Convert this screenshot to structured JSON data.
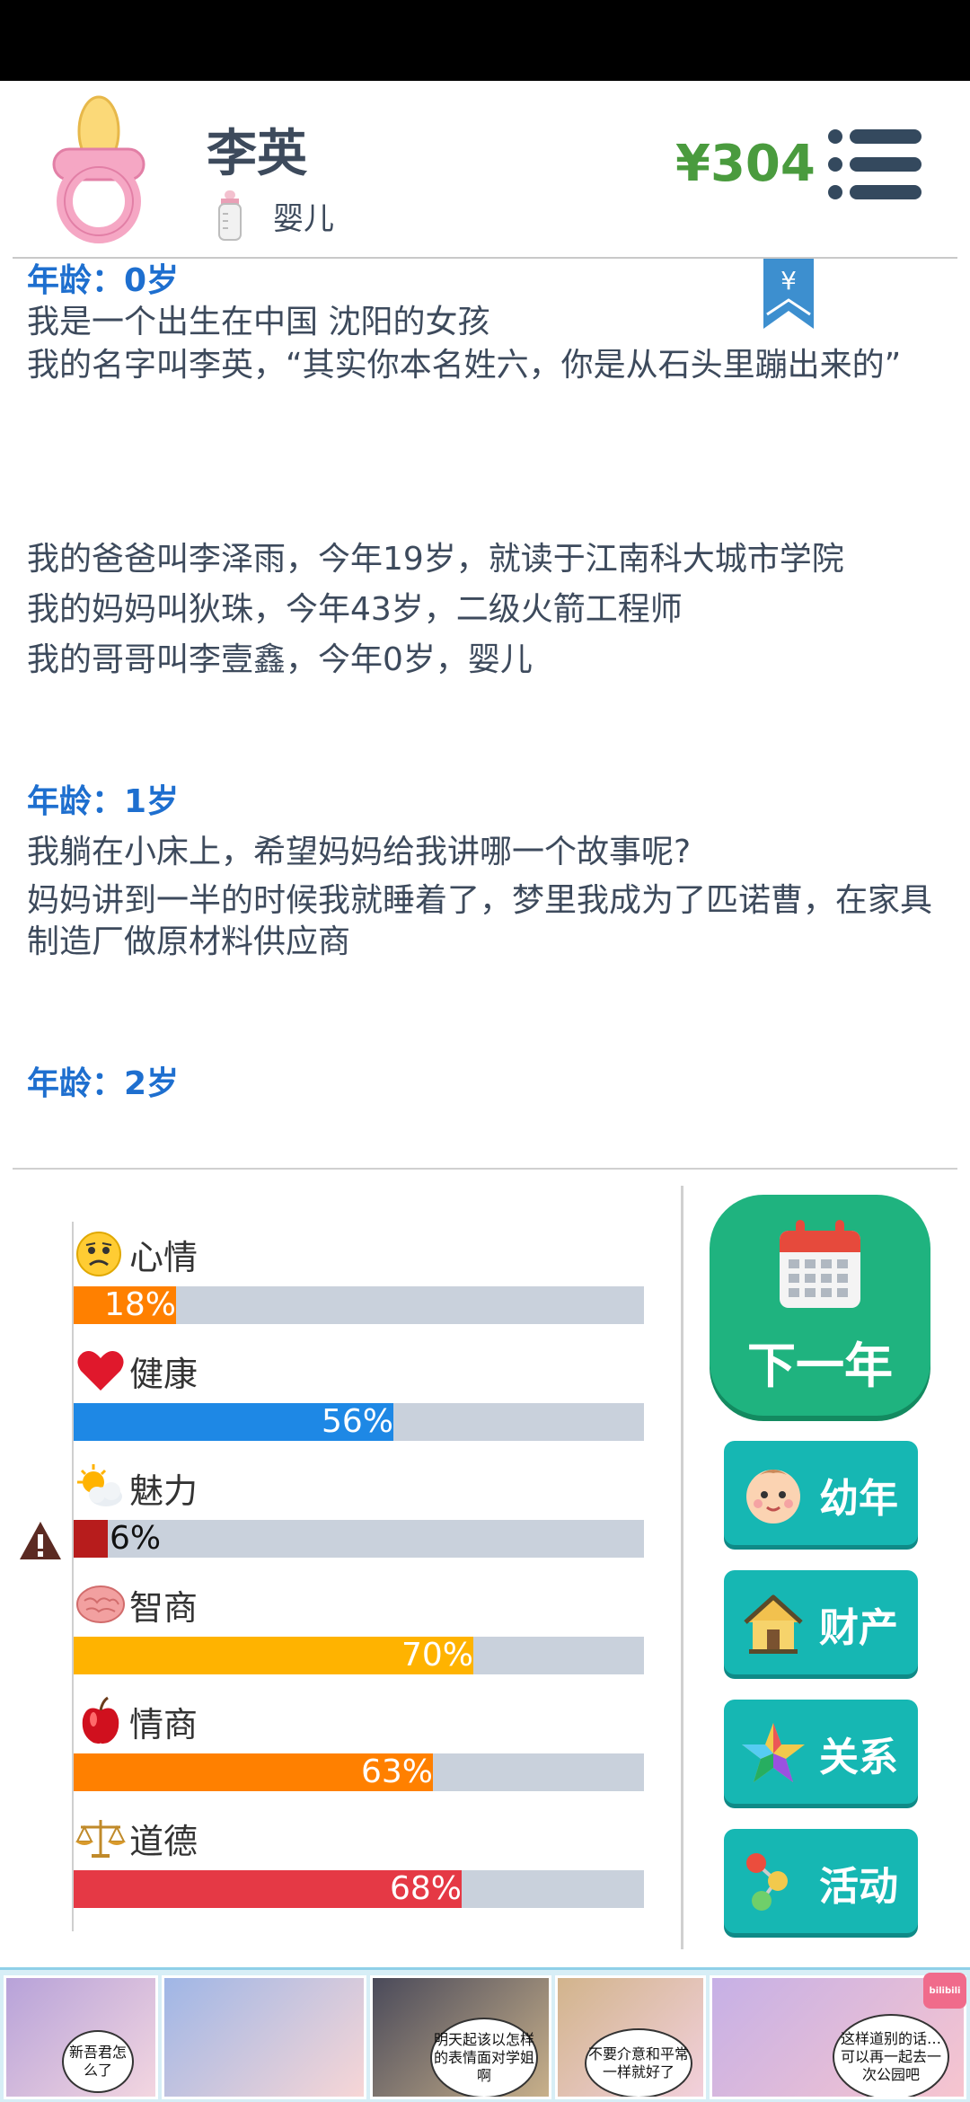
{
  "header": {
    "name": "李英",
    "stage_label": "婴儿",
    "money": "¥304"
  },
  "story": {
    "bookmark_symbol": "¥",
    "entries": [
      {
        "age_label": "年龄：0岁",
        "lines": [
          "我是一个出生在中国 沈阳的女孩",
          "我的名字叫李英，“其实你本名姓六，你是从石头里蹦出来的”",
          "",
          "我的爸爸叫李泽雨，今年19岁，就读于江南科大城市学院",
          "我的妈妈叫狄珠，今年43岁，二级火箭工程师",
          "我的哥哥叫李壹鑫，今年0岁，婴儿"
        ]
      },
      {
        "age_label": "年龄：1岁",
        "lines": [
          "我躺在小床上，希望妈妈给我讲哪一个故事呢?",
          "妈妈讲到一半的时候我就睡着了，梦里我成为了匹诺曹，在家具制造厂做原材料供应商"
        ]
      },
      {
        "age_label": "年龄：2岁",
        "lines": []
      }
    ]
  },
  "stats": [
    {
      "label": "心情",
      "value": 18,
      "text": "18%",
      "color": "#ff8000",
      "icon": "sad-face-icon"
    },
    {
      "label": "健康",
      "value": 56,
      "text": "56%",
      "color": "#1e88e5",
      "icon": "heart-icon"
    },
    {
      "label": "魅力",
      "value": 6,
      "text": "6%",
      "color": "#b71c1c",
      "icon": "sun-cloud-icon",
      "warning": true
    },
    {
      "label": "智商",
      "value": 70,
      "text": "70%",
      "color": "#ffb300",
      "icon": "brain-icon"
    },
    {
      "label": "情商",
      "value": 63,
      "text": "63%",
      "color": "#ff8000",
      "icon": "apple-icon"
    },
    {
      "label": "道德",
      "value": 68,
      "text": "68%",
      "color": "#e53945",
      "icon": "scales-icon"
    }
  ],
  "actions": {
    "next_year": "下一年",
    "childhood": "幼年",
    "property": "财产",
    "relations": "关系",
    "activities": "活动"
  },
  "ad": {
    "bubble1": "新吾君怎么了",
    "bubble2": "明天起该以怎样的表情面对学姐啊",
    "bubble3": "不要介意和平常一样就好了",
    "bubble4": "这样道别的话…可以再一起去一次公园吧",
    "logo": "bilibili"
  }
}
